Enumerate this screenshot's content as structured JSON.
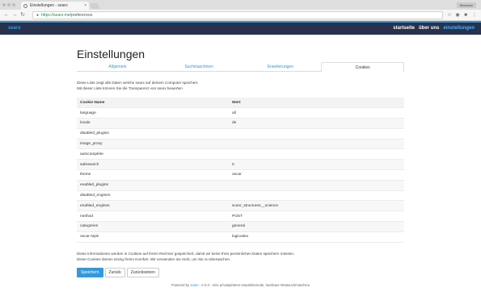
{
  "browser": {
    "tab_title": "Einstellungen - searx",
    "tab_close": "×",
    "user_chip": "Benutzer",
    "url_host": "https://searx.me",
    "url_path": "/preferences"
  },
  "site": {
    "brand": "searx",
    "nav": [
      {
        "label": "startseite",
        "active": false
      },
      {
        "label": "über uns",
        "active": false
      },
      {
        "label": "einstellungen",
        "active": true
      }
    ]
  },
  "page": {
    "title": "Einstellungen",
    "tabs": [
      {
        "label": "Allgemein",
        "active": false
      },
      {
        "label": "Suchmaschinen",
        "active": false
      },
      {
        "label": "Erweiterungen",
        "active": false
      },
      {
        "label": "Cookies",
        "active": true
      }
    ],
    "intro_line1": "Diese Liste zeigt alle Daten welche searx auf deinem Computer speichert.",
    "intro_line2": "Mit dieser Liste können Sie die Transparenz von searx bewerten",
    "table": {
      "headers": [
        "Cookie Name",
        "Wert"
      ],
      "rows": [
        [
          "language",
          "all"
        ],
        [
          "locale",
          "de"
        ],
        [
          "disabled_plugins",
          ""
        ],
        [
          "image_proxy",
          ""
        ],
        [
          "autocomplete",
          ""
        ],
        [
          "safesearch",
          "0"
        ],
        [
          "theme",
          "oscar"
        ],
        [
          "enabled_plugins",
          ""
        ],
        [
          "disabled_engines",
          ""
        ],
        [
          "enabled_engines",
          "scanr_structures__science"
        ],
        [
          "method",
          "POST"
        ],
        [
          "categories",
          "general"
        ],
        [
          "oscar-style",
          "logicodev"
        ]
      ]
    },
    "footnote_line1": "Diese Informationen werden in Cookies auf Ihrem Rechner gespeichert, damit wir keine Ihrer persönlichen Daten speichern müssen.",
    "footnote_line2": "Diese Cookies dienen einzig Ihrem Komfort. Wir verwenden sie nicht, um Sie zu überwachen.",
    "buttons": {
      "save": "Speichern",
      "back": "Zurück",
      "reset": "Zurücksetzen"
    },
    "powered_prefix": "Powered by",
    "powered_link": "searx",
    "powered_suffix": " - 0.X.0 - eine privatsphären-respektierende, hackbare Metasuchmaschine"
  }
}
